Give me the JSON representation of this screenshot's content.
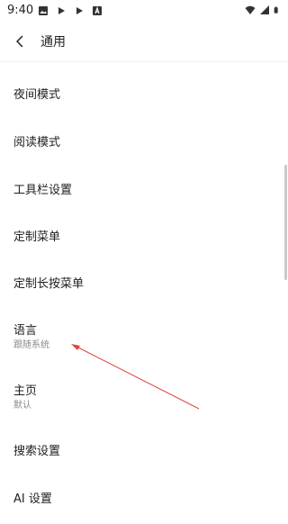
{
  "status_bar": {
    "time": "9:40",
    "left_icons": [
      "image-icon",
      "play-icon",
      "play-icon",
      "a-box-icon"
    ],
    "right_icons": [
      "wifi-icon",
      "signal-icon",
      "battery-icon"
    ]
  },
  "header": {
    "back_icon": "chevron-left-icon",
    "title": "通用"
  },
  "settings": {
    "items": [
      {
        "label": "夜间模式"
      },
      {
        "label": "阅读模式"
      },
      {
        "label": "工具栏设置"
      },
      {
        "label": "定制菜单"
      },
      {
        "label": "定制长按菜单"
      },
      {
        "label": "语言",
        "sub": "跟随系统"
      },
      {
        "label": "主页",
        "sub": "默认"
      },
      {
        "label": "搜索设置"
      },
      {
        "label": "AI 设置"
      }
    ]
  },
  "colors": {
    "annotation_arrow": "#e0443e",
    "secondary_text": "#8a8a8a"
  }
}
